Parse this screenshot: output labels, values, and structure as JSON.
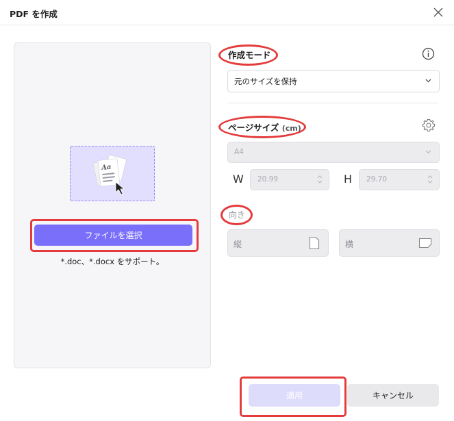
{
  "window": {
    "title": "PDF を作成"
  },
  "left": {
    "choose_button": "ファイルを選択",
    "support_text": "*.doc、*.docx をサポート。"
  },
  "creation_mode": {
    "label": "作成モード",
    "selected": "元のサイズを保持"
  },
  "page_size": {
    "label": "ページサイズ",
    "unit": "(cm)",
    "selected": "A4",
    "width_label": "W",
    "width_value": "20.99",
    "height_label": "H",
    "height_value": "29.70"
  },
  "orientation": {
    "label": "向き",
    "portrait": "縦",
    "landscape": "横"
  },
  "footer": {
    "apply": "適用",
    "cancel": "キャンセル"
  },
  "colors": {
    "accent": "#7a6ffa",
    "annotation": "#e43c3c",
    "dropzone": "#e2defd"
  }
}
